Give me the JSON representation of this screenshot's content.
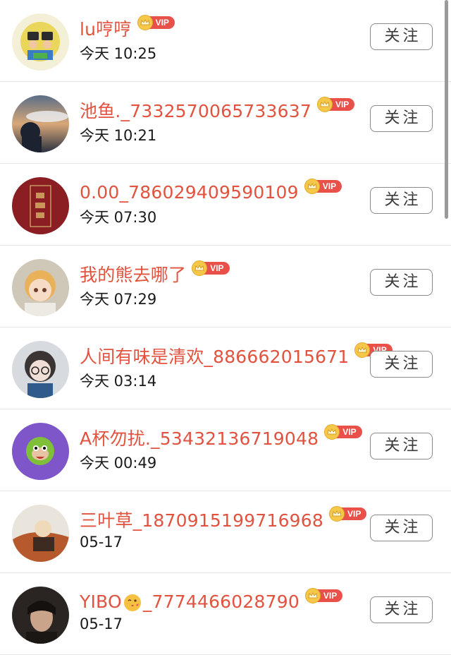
{
  "follow_label": "关注",
  "vip_label": "VIP",
  "colors": {
    "name": "#e2533f",
    "vip_tag": "#e9504a",
    "vip_crown": "#f5c84a",
    "button_border": "#8a8a8a"
  },
  "users": [
    {
      "name": "lu哼哼",
      "time": "今天 10:25",
      "avatar_icon": "cartoon-kids-avatar"
    },
    {
      "name": "池鱼._7332570065733637",
      "time": "今天 10:21",
      "avatar_icon": "astronaut-avatar"
    },
    {
      "name": "0.00_786029409590109",
      "time": "今天 07:30",
      "avatar_icon": "red-seal-avatar"
    },
    {
      "name": "我的熊去哪了",
      "time": "今天 07:29",
      "avatar_icon": "anime-girl-avatar"
    },
    {
      "name": "人间有味是清欢_886662015671",
      "time": "今天 03:14",
      "avatar_icon": "doll-avatar"
    },
    {
      "name": "A杯勿扰._53432136719048",
      "time": "今天 00:49",
      "avatar_icon": "monkey-avatar"
    },
    {
      "name": "三叶草_1870915199716968",
      "time": "05-17",
      "avatar_icon": "painting-avatar"
    },
    {
      "name_prefix": "YIBO",
      "name_emoji": "kissing-face-emoji",
      "name_suffix": "_7774466028790",
      "time": "05-17",
      "avatar_icon": "portrait-avatar"
    }
  ]
}
